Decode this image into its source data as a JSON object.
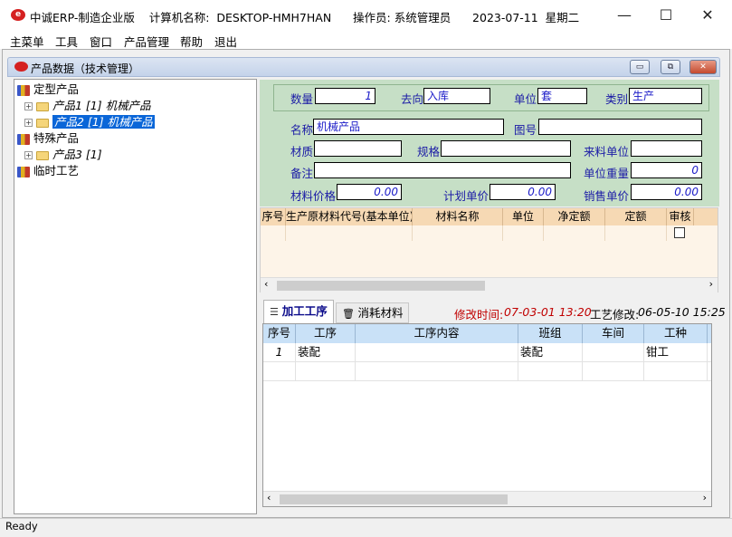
{
  "app": {
    "icon": "app-logo-icon",
    "title": "中诚ERP-制造企业版    计算机名称:  DESKTOP-HMH7HAN      操作员: 系统管理员      2023-07-11  星期二"
  },
  "window_controls": {
    "minimize": "—",
    "maximize": "☐",
    "close": "✕"
  },
  "menu": [
    "主菜单",
    "工具",
    "窗口",
    "产品管理",
    "帮助",
    "退出"
  ],
  "child_window": {
    "title": "产品数据（技术管理）",
    "buttons": {
      "minimize": "▭",
      "restore": "⧉",
      "close": "✕"
    }
  },
  "tree": {
    "nodes": [
      {
        "level": 0,
        "label": "定型产品"
      },
      {
        "level": 1,
        "label": "产品1  [1] 机械产品"
      },
      {
        "level": 1,
        "label": "产品2  [1] 机械产品",
        "selected": true
      },
      {
        "level": 0,
        "label": "特殊产品"
      },
      {
        "level": 1,
        "label": "产品3  [1]"
      },
      {
        "level": 0,
        "label": "临时工艺"
      }
    ]
  },
  "form": {
    "qty_label": "数量",
    "qty_value": "1",
    "dest_label": "去向",
    "dest_value": "入库",
    "unit_label": "单位",
    "unit_value": "套",
    "category_label": "类别",
    "category_value": "生产",
    "name_label": "名称",
    "name_value": "机械产品",
    "drawing_label": "图号",
    "drawing_value": "",
    "material_label": "材质",
    "material_value": "",
    "spec_label": "规格",
    "spec_value": "",
    "incoming_unit_label": "来料单位",
    "incoming_unit_value": "",
    "remark_label": "备注",
    "remark_value": "",
    "unit_weight_label": "单位重量",
    "unit_weight_value": "0",
    "material_price_label": "材料价格",
    "material_price_value": "0.00",
    "plan_price_label": "计划单价",
    "plan_price_value": "0.00",
    "sale_price_label": "销售单价",
    "sale_price_value": "0.00"
  },
  "material_grid": {
    "columns": [
      "序号",
      "生产原材料代号(基本单位)",
      "材料名称",
      "单位",
      "净定额",
      "定额",
      "审核"
    ]
  },
  "tabs": [
    {
      "label": "加工工序",
      "icon": "process-list-icon",
      "active": true
    },
    {
      "label": "消耗材料",
      "icon": "trash-icon",
      "active": false
    }
  ],
  "modified": {
    "label": "修改时间:",
    "value": "07-03-01 13:20",
    "color": "#c00000"
  },
  "craft_modified": {
    "label": "工艺修改:",
    "value": "06-05-10 15:25"
  },
  "ops_grid": {
    "columns": [
      "序号",
      "工序",
      "工序内容",
      "班组",
      "车间",
      "工种"
    ],
    "rows": [
      [
        "1",
        "装配",
        "",
        "装配",
        "",
        "钳工"
      ]
    ]
  },
  "status": "Ready"
}
